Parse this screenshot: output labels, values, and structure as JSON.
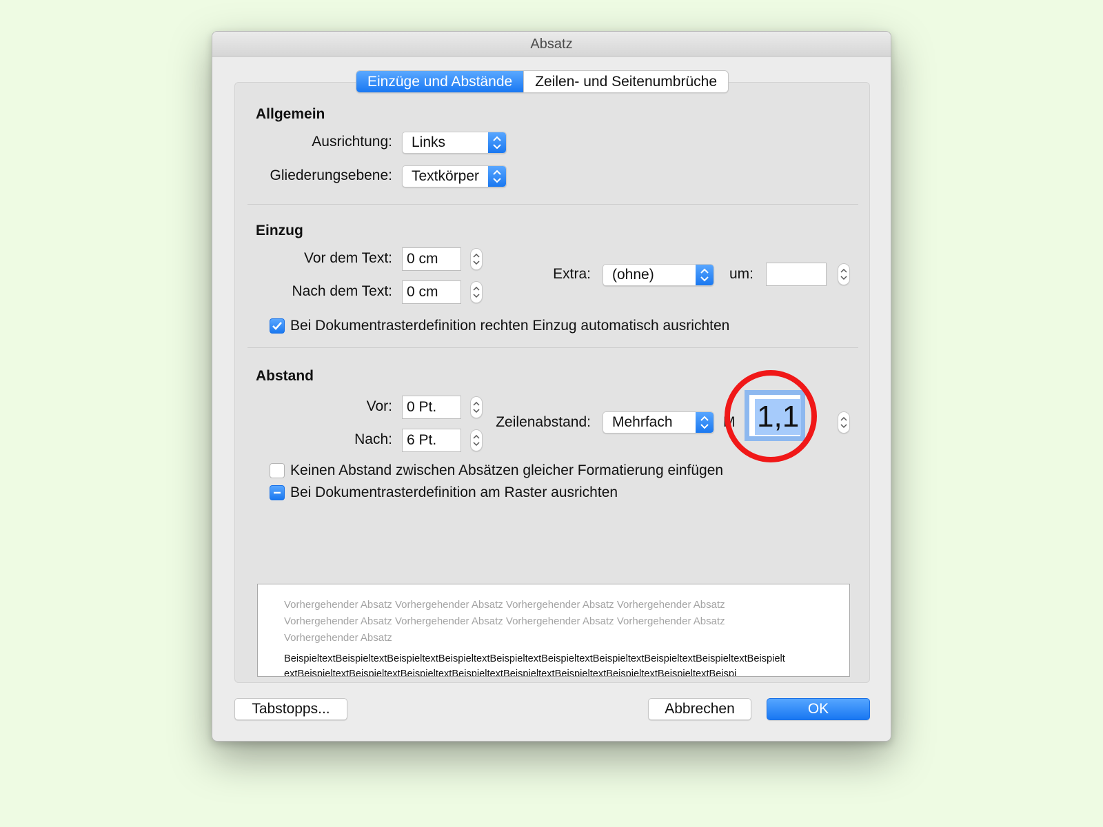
{
  "window": {
    "title": "Absatz"
  },
  "tabs": [
    {
      "label": "Einzüge und Abstände",
      "active": true
    },
    {
      "label": "Zeilen- und Seitenumbrüche",
      "active": false
    }
  ],
  "allgemein": {
    "heading": "Allgemein",
    "ausrichtung_label": "Ausrichtung:",
    "ausrichtung_value": "Links",
    "gliederung_label": "Gliederungsebene:",
    "gliederung_value": "Textkörper"
  },
  "einzug": {
    "heading": "Einzug",
    "vor_label": "Vor dem Text:",
    "vor_value": "0 cm",
    "nach_label": "Nach dem Text:",
    "nach_value": "0 cm",
    "extra_label": "Extra:",
    "extra_value": "(ohne)",
    "um_label": "um:",
    "um_value": "",
    "auto_checkbox_label": "Bei Dokumentrasterdefinition rechten Einzug automatisch ausrichten",
    "auto_checked": true
  },
  "abstand": {
    "heading": "Abstand",
    "vor_label": "Vor:",
    "vor_value": "0  Pt.",
    "nach_label": "Nach:",
    "nach_value": "6  Pt.",
    "zeilenabstand_label": "Zeilenabstand:",
    "zeilenabstand_value": "Mehrfach",
    "mass_label_partial": "M",
    "mass_value": "1,1",
    "keinen_abstand_label": "Keinen Abstand zwischen Absätzen gleicher Formatierung einfügen",
    "keinen_abstand_checked": false,
    "raster_label": "Bei Dokumentrasterdefinition am Raster ausrichten",
    "raster_state": "mixed"
  },
  "preview": {
    "previous_text": "Vorhergehender Absatz Vorhergehender Absatz Vorhergehender Absatz Vorhergehender Absatz Vorhergehender Absatz Vorhergehender Absatz Vorhergehender Absatz Vorhergehender Absatz Vorhergehender Absatz",
    "sample_line_1": "BeispieltextBeispieltextBeispieltextBeispieltextBeispieltextBeispieltextBeispieltextBeispieltextBeispieltextBeispielt",
    "sample_line_2": "extBeispieltextBeispieltextBeispieltextBeispieltextBeispieltextBeispieltextBeispieltextBeispieltextBeispi"
  },
  "buttons": {
    "tabstopps": "Tabstopps...",
    "abbrechen": "Abbrechen",
    "ok": "OK"
  },
  "colors": {
    "accent": "#1a78f0",
    "highlight_ring": "#f01818",
    "background": "#eefbe3"
  }
}
